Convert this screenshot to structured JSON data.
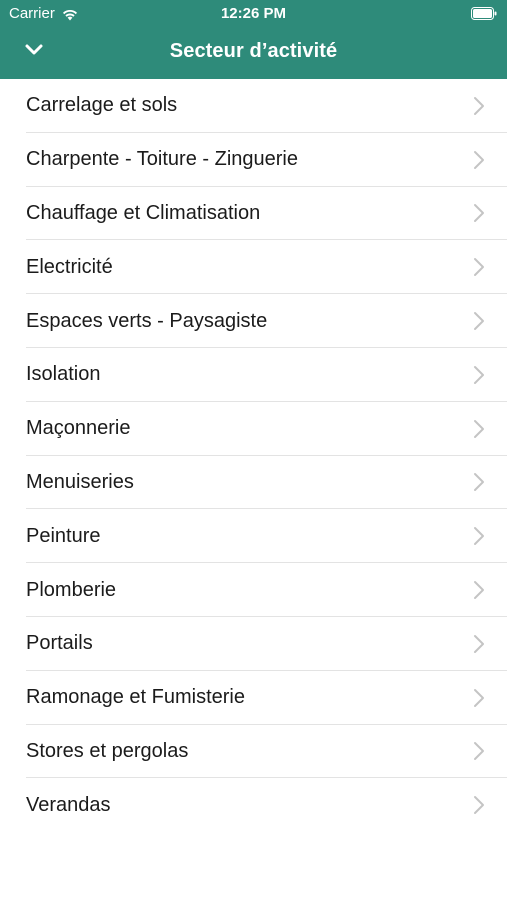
{
  "status_bar": {
    "carrier": "Carrier",
    "time": "12:26 PM",
    "wifi_icon": "wifi-icon",
    "battery_icon": "battery-icon"
  },
  "nav": {
    "title": "Secteur d’activité",
    "back_icon": "chevron-down-icon"
  },
  "colors": {
    "header_background": "#2e8b7a",
    "header_text": "#ffffff",
    "list_text": "#1b1b1b",
    "separator": "#e3e3e3",
    "chevron": "#c4c4c4"
  },
  "sectors": [
    {
      "label": "Carrelage et sols"
    },
    {
      "label": "Charpente - Toiture - Zinguerie"
    },
    {
      "label": "Chauffage et Climatisation"
    },
    {
      "label": "Electricité"
    },
    {
      "label": "Espaces verts - Paysagiste"
    },
    {
      "label": "Isolation"
    },
    {
      "label": "Maçonnerie"
    },
    {
      "label": "Menuiseries"
    },
    {
      "label": "Peinture"
    },
    {
      "label": "Plomberie"
    },
    {
      "label": "Portails"
    },
    {
      "label": "Ramonage et Fumisterie"
    },
    {
      "label": "Stores et pergolas"
    },
    {
      "label": "Verandas"
    }
  ]
}
